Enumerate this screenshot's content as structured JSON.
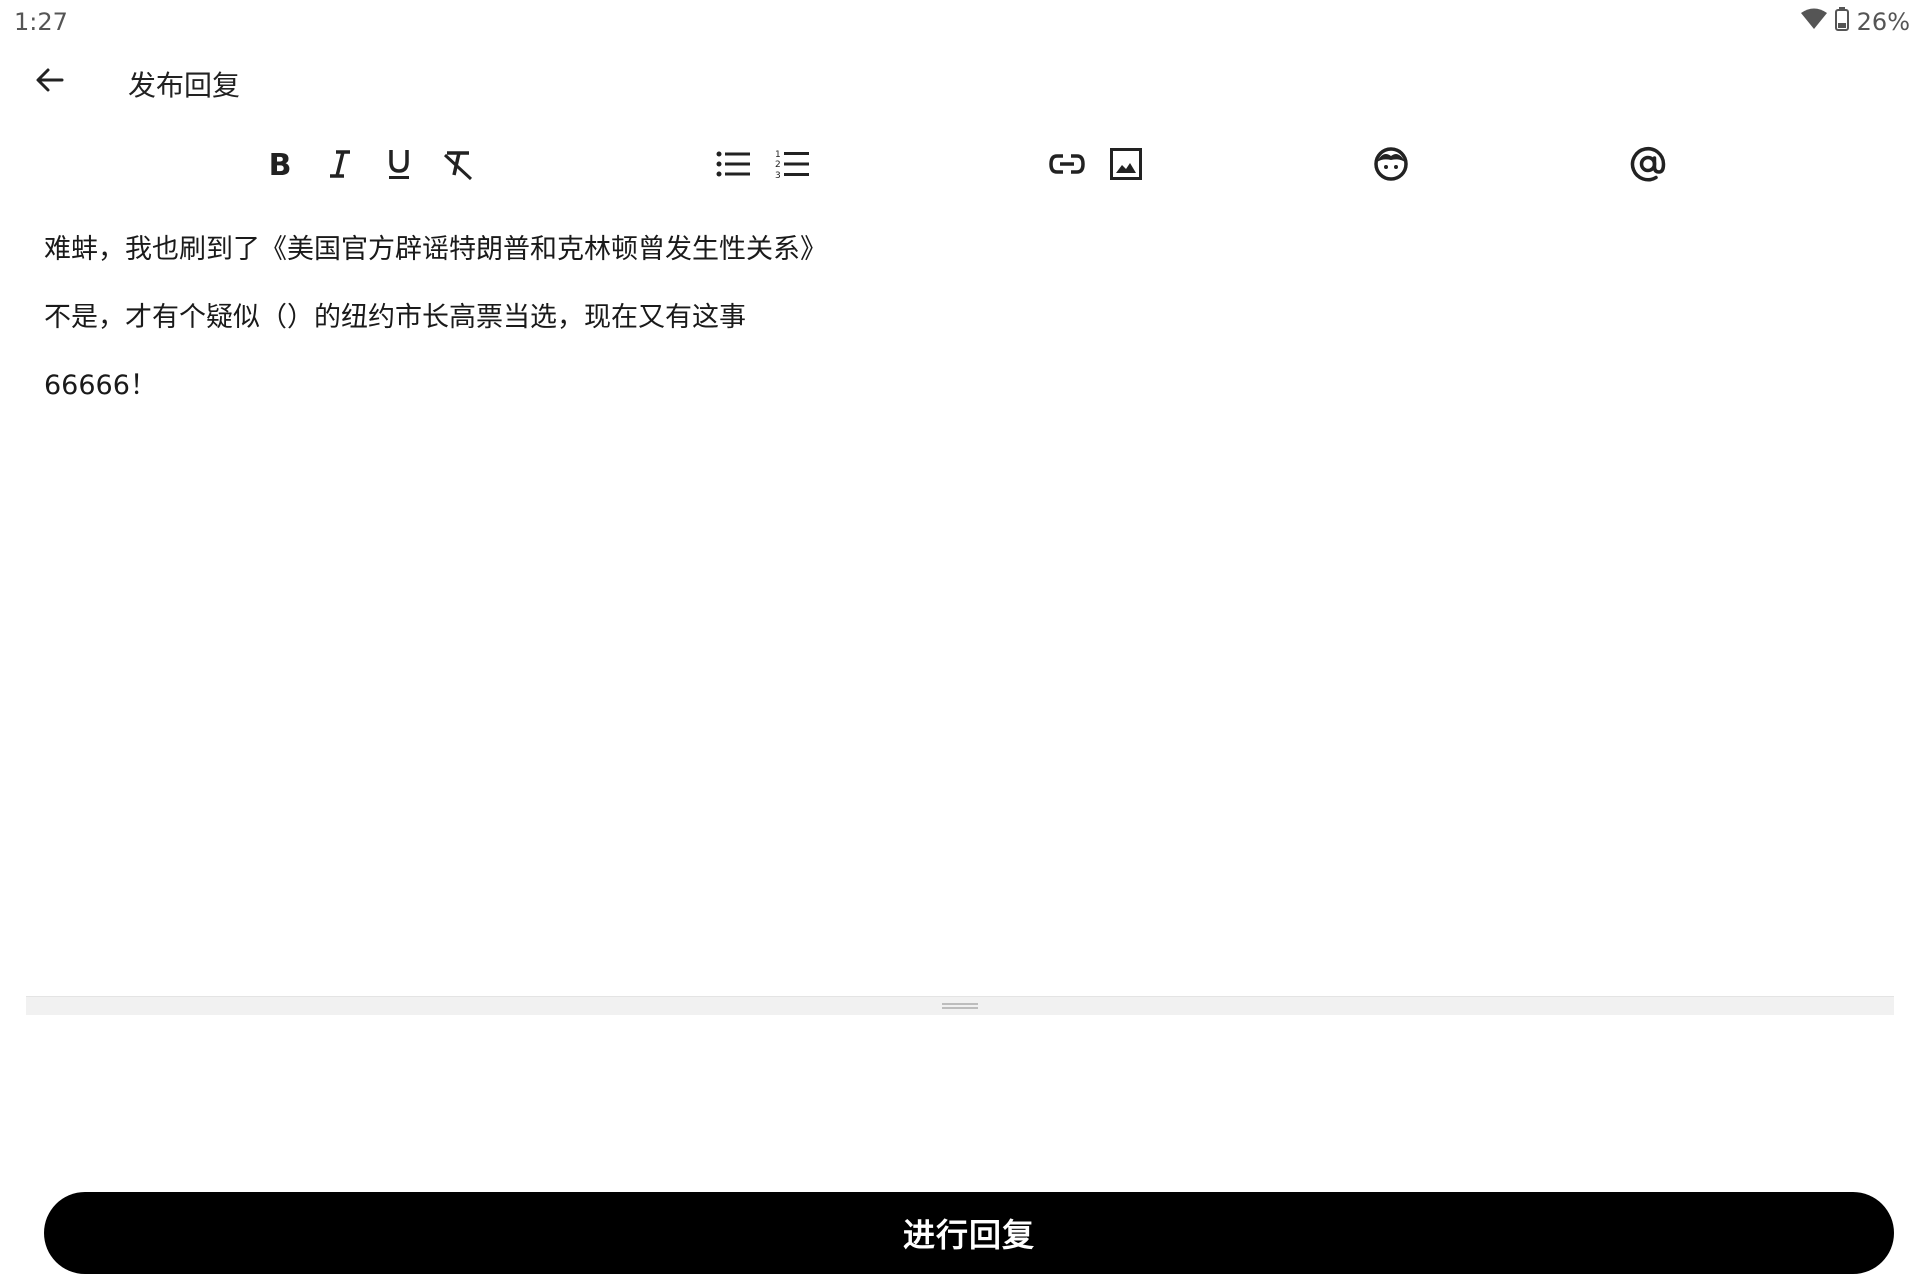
{
  "status_bar": {
    "time": "1:27",
    "battery": "26%",
    "icons": [
      "wifi-icon",
      "battery-icon"
    ]
  },
  "app_bar": {
    "back_icon": "arrow-left-icon",
    "title": "发布回复"
  },
  "toolbar": {
    "buttons": [
      {
        "name": "bold",
        "icon": "bold-icon"
      },
      {
        "name": "italic",
        "icon": "italic-icon"
      },
      {
        "name": "underline",
        "icon": "underline-icon"
      },
      {
        "name": "clear-format",
        "icon": "clear-format-icon"
      },
      {
        "name": "bulleted-list",
        "icon": "bulleted-list-icon"
      },
      {
        "name": "numbered-list",
        "icon": "numbered-list-icon"
      },
      {
        "name": "link",
        "icon": "link-icon"
      },
      {
        "name": "image",
        "icon": "image-icon"
      },
      {
        "name": "emoji",
        "icon": "emoji-icon"
      },
      {
        "name": "mention",
        "icon": "at-icon"
      }
    ]
  },
  "editor": {
    "lines": [
      "难蚌，我也刷到了《美国官方辟谣特朗普和克林顿曾发生性关系》",
      "不是，才有个疑似（）的纽约市长高票当选，现在又有这事",
      "66666！"
    ]
  },
  "submit": {
    "label": "进行回复"
  },
  "colors": {
    "background": "#ffffff",
    "submit_bg": "#000000",
    "submit_text": "#ffffff",
    "text": "#1a1a1a"
  }
}
